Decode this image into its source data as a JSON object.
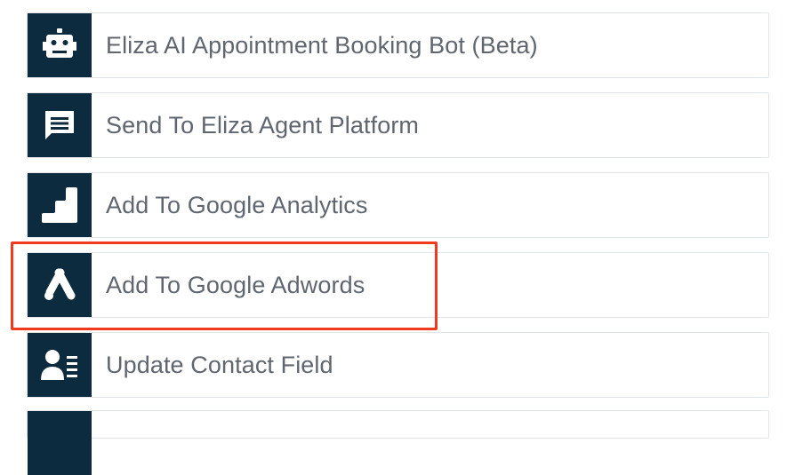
{
  "colors": {
    "icon_bg": "#0d2b3e",
    "highlight": "#ef3a1d",
    "label": "#5f6670"
  },
  "actions": [
    {
      "label": "Eliza AI Appointment Booking Bot (Beta)",
      "icon": "robot-icon"
    },
    {
      "label": "Send To Eliza Agent Platform",
      "icon": "chat-bubble-icon"
    },
    {
      "label": "Add To Google Analytics",
      "icon": "google-analytics-icon"
    },
    {
      "label": "Add To Google Adwords",
      "icon": "google-ads-icon",
      "highlighted": true
    },
    {
      "label": "Update Contact Field",
      "icon": "contact-field-icon"
    },
    {
      "label": "",
      "icon": ""
    }
  ]
}
